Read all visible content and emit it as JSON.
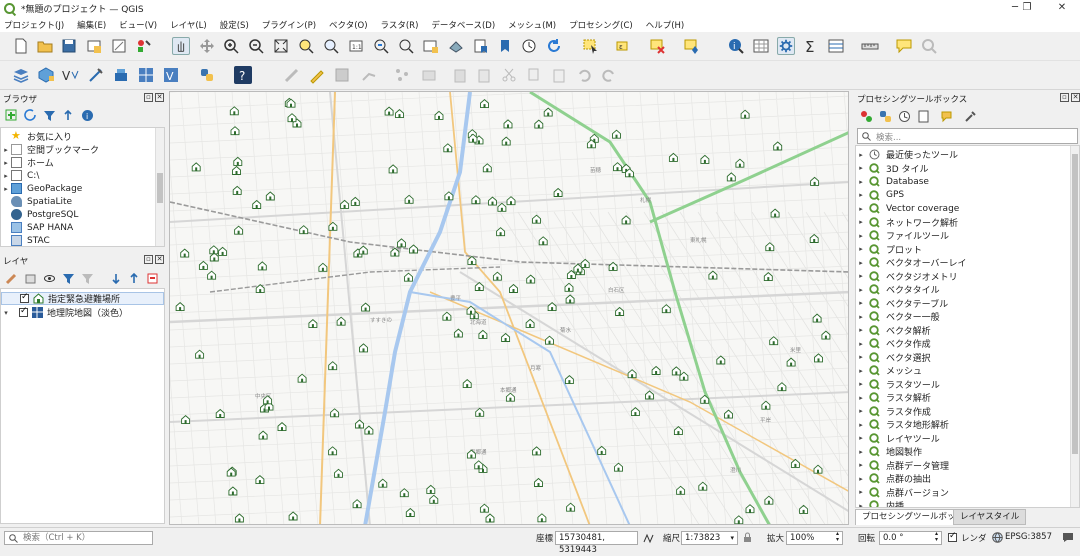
{
  "app": {
    "title": "*無題のプロジェクト — QGIS"
  },
  "menu": [
    "プロジェクト(J)",
    "編集(E)",
    "ビュー(V)",
    "レイヤ(L)",
    "設定(S)",
    "プラグイン(P)",
    "ベクタ(O)",
    "ラスタ(R)",
    "データベース(D)",
    "メッシュ(M)",
    "プロセシング(C)",
    "ヘルプ(H)"
  ],
  "browser": {
    "title": "ブラウザ",
    "items": [
      "お気に入り",
      "空間ブックマーク",
      "ホーム",
      "C:\\",
      "GeoPackage",
      "SpatiaLite",
      "PostgreSQL",
      "SAP HANA",
      "STAC"
    ]
  },
  "layers": {
    "title": "レイヤ",
    "items": [
      "指定緊急避難場所",
      "地理院地図（淡色）"
    ]
  },
  "processing": {
    "title": "プロセシングツールボックス",
    "search_placeholder": "検索...",
    "items": [
      "最近使ったツール",
      "3D タイル",
      "Database",
      "GPS",
      "Vector coverage",
      "ネットワーク解析",
      "ファイルツール",
      "プロット",
      "ベクタオーバーレイ",
      "ベクタジオメトリ",
      "ベクタタイル",
      "ベクタテーブル",
      "ベクター一般",
      "ベクタ解析",
      "ベクタ作成",
      "ベクタ選択",
      "メッシュ",
      "ラスタツール",
      "ラスタ解析",
      "ラスタ作成",
      "ラスタ地形解析",
      "レイヤツール",
      "地図製作",
      "点群データ管理",
      "点群の抽出",
      "点群バージョン",
      "内挿"
    ]
  },
  "tabs": {
    "toolbox": "プロセシングツールボックス",
    "layer_style": "レイヤスタイル"
  },
  "status": {
    "search_placeholder": "検索（Ctrl + K）",
    "coord_label": "座標",
    "coord_value": "15730481, 5319443",
    "scale_label": "縮尺",
    "scale_value": "1:73823",
    "magnify_label": "拡大",
    "magnify_value": "100%",
    "rotation_label": "回転",
    "rotation_value": "0.0 °",
    "render_label": "レンダ",
    "crs": "EPSG:3857"
  },
  "map_labels": [
    "白石区",
    "中央区",
    "北海道",
    "東札幌",
    "菊水",
    "南郷通",
    "月寒",
    "豊平",
    "澄川",
    "平岸",
    "札幌",
    "大通",
    "すすきの",
    "苗穂",
    "本郷通",
    "米里"
  ]
}
